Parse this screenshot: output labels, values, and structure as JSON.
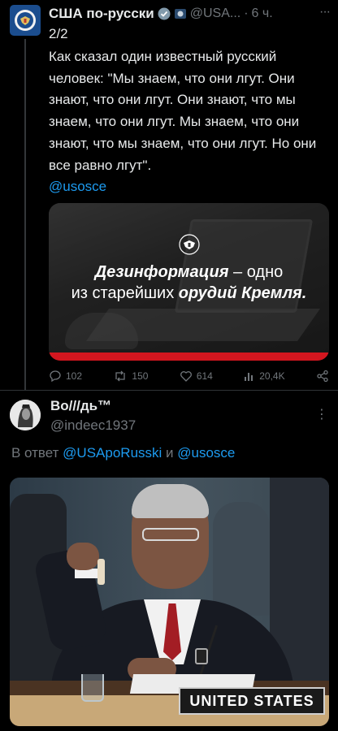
{
  "tweet1": {
    "author_name": "США по-русски",
    "handle": "@USA...",
    "time": "6 ч.",
    "more": "···",
    "counter": "2/2",
    "text": "Как сказал один известный русский человек: \"Мы знаем, что они лгут. Они знают, что они лгут. Они знают, что мы знаем, что они лгут. Мы знаем, что они знают, что мы знаем, что они лгут. Но они все равно лгут\".",
    "mention": "@usosce",
    "card": {
      "line1_bold": "Дезинформация",
      "line1_rest": " – одно",
      "line2_start": "из старейших ",
      "line2_bold": "орудий Кремля."
    },
    "actions": {
      "replies": "102",
      "retweets": "150",
      "likes": "614",
      "views": "20,4K"
    }
  },
  "tweet2": {
    "author_name": "Во///дь™",
    "handle": "@indeec1937",
    "more": "⋮",
    "reply_prefix": "В ответ ",
    "reply_mention1": "@USApoRusski",
    "reply_and": " и ",
    "reply_mention2": "@usosce",
    "photo": {
      "nameplate": "UNITED STATES"
    }
  },
  "colors": {
    "background": "#000000",
    "text": "#e7e9ea",
    "muted": "#71767b",
    "link": "#1d9bf0",
    "card_bar": "#d3161f"
  }
}
